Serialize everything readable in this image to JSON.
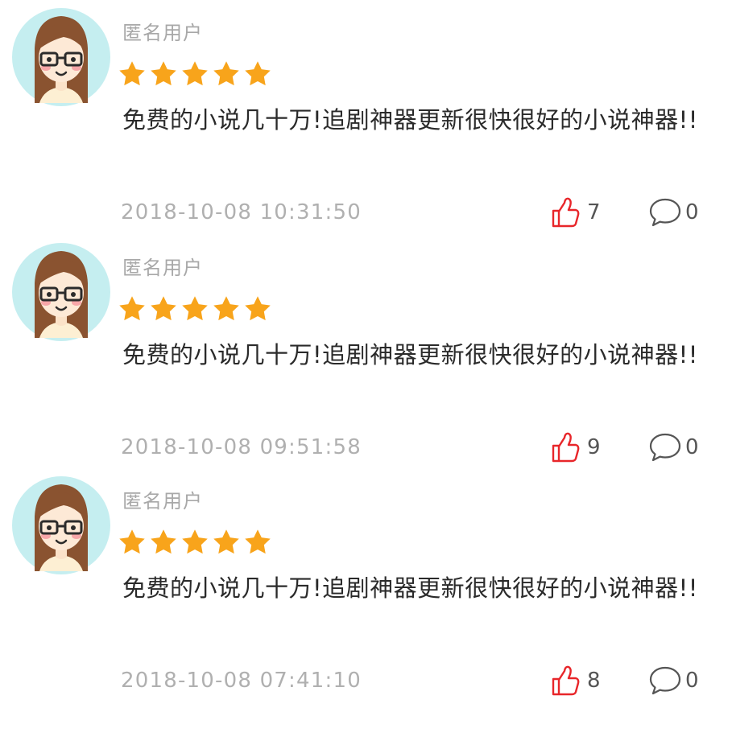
{
  "colors": {
    "star": "#f8a41b",
    "like_icon": "#e8262a",
    "avatar_bg": "#c5eef0",
    "username": "#a8a8a8",
    "timestamp": "#b0b0b0",
    "comment_text": "#2a2a2a"
  },
  "reviews": [
    {
      "username": "匿名用户",
      "rating": 5,
      "comment": "免费的小说几十万!追剧神器更新很快很好的小说神器!!",
      "timestamp": "2018-10-08 10:31:50",
      "likes": "7",
      "replies": "0"
    },
    {
      "username": "匿名用户",
      "rating": 5,
      "comment": "免费的小说几十万!追剧神器更新很快很好的小说神器!!",
      "timestamp": "2018-10-08 09:51:58",
      "likes": "9",
      "replies": "0"
    },
    {
      "username": "匿名用户",
      "rating": 5,
      "comment": "免费的小说几十万!追剧神器更新很快很好的小说神器!!",
      "timestamp": "2018-10-08 07:41:10",
      "likes": "8",
      "replies": "0"
    }
  ]
}
